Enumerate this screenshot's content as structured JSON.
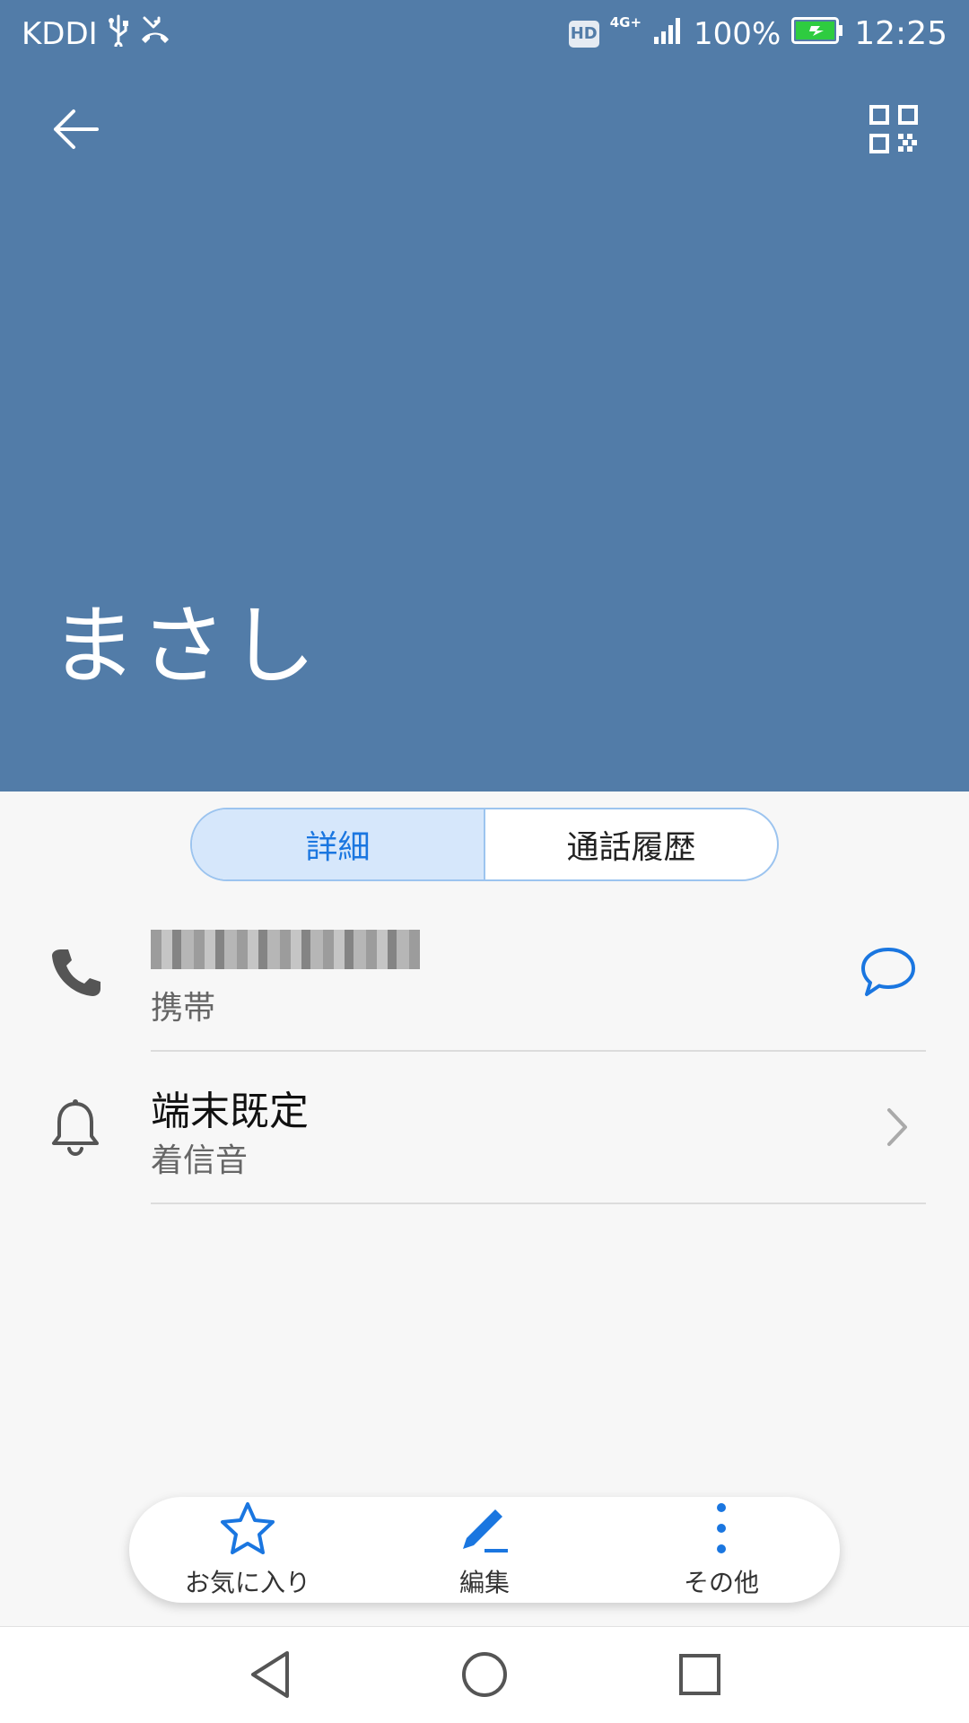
{
  "status_bar": {
    "carrier": "KDDI",
    "hd_badge": "HD",
    "network": "4G+",
    "battery": "100%",
    "time": "12:25",
    "icons": [
      "usb-icon",
      "missed-call-icon",
      "hd-voice-icon",
      "signal-icon",
      "battery-charging-icon"
    ]
  },
  "header": {
    "background_color": "#527ca8",
    "contact_name": "まさし",
    "back_icon": "back-arrow-icon",
    "qr_icon": "qr-code-icon"
  },
  "tabs": [
    {
      "label": "詳細",
      "active": true
    },
    {
      "label": "通話履歴",
      "active": false
    }
  ],
  "details": {
    "phone": {
      "number": "",
      "type_label": "携帯",
      "icon": "phone-icon",
      "action_icon": "message-icon"
    },
    "ringtone": {
      "value": "端末既定",
      "label": "着信音",
      "icon": "bell-icon",
      "action_icon": "chevron-right-icon"
    }
  },
  "actions": [
    {
      "label": "お気に入り",
      "icon": "star-icon"
    },
    {
      "label": "編集",
      "icon": "edit-icon"
    },
    {
      "label": "その他",
      "icon": "more-vertical-icon"
    }
  ],
  "accent_color": "#1a76e0",
  "nav": [
    "back-nav-icon",
    "home-nav-icon",
    "recents-nav-icon"
  ]
}
